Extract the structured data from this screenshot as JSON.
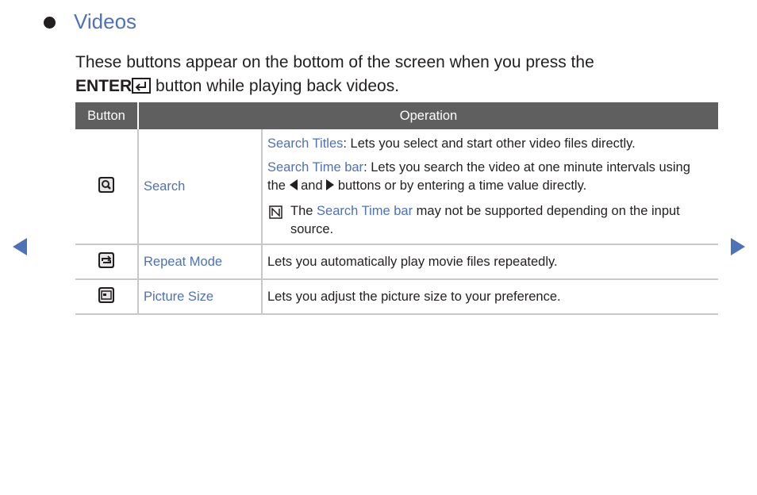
{
  "section": {
    "title": "Videos",
    "intro_before": "These buttons appear on the bottom of the screen when you press the",
    "intro_key": "ENTER",
    "intro_after": " button while playing back videos."
  },
  "table": {
    "headers": [
      "Button",
      "Operation"
    ],
    "rows": [
      {
        "icon": "search-icon",
        "name": "Search",
        "items": [
          {
            "term": "Search Titles",
            "text": ": Lets you select and start other video files directly."
          },
          {
            "term": "Search Time bar",
            "text_before": ": Lets you search the video at one minute intervals using the ",
            "and": " and ",
            "text_after": " buttons or by entering a time value directly."
          }
        ],
        "note": {
          "before": "The ",
          "term": "Search Time bar",
          "after": " may not be supported depending on the input source."
        }
      },
      {
        "icon": "repeat-icon",
        "name": "Repeat Mode",
        "text": "Lets you automatically play movie files repeatedly."
      },
      {
        "icon": "picture-size-icon",
        "name": "Picture Size",
        "text": "Lets you adjust the picture size to your preference."
      }
    ]
  },
  "colors": {
    "accent": "#4f71b5",
    "header_bg": "#5f5f5f",
    "text": "#231f20"
  }
}
